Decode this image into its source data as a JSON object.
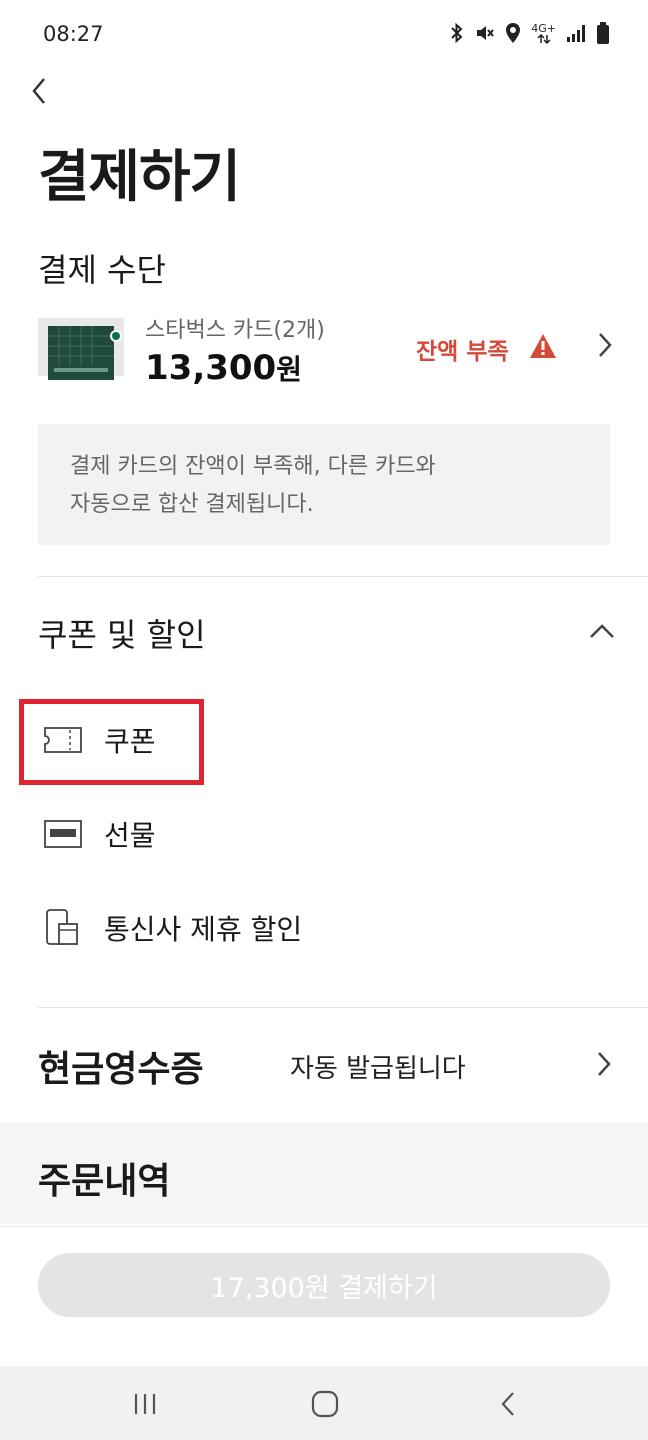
{
  "status_bar": {
    "time": "08:27",
    "icons": [
      "bluetooth-icon",
      "mute-icon",
      "location-icon",
      "network-4g-icon",
      "signal-icon",
      "battery-icon"
    ],
    "network_label": "4G+"
  },
  "header": {
    "back_icon": "chevron-left-icon",
    "title": "결제하기"
  },
  "payment_method": {
    "section_title": "결제 수단",
    "card": {
      "name": "스타벅스 카드(2개)",
      "amount": "13,300",
      "amount_unit": "원",
      "balance_status": "잔액 부족",
      "warning_icon": "warning-triangle-icon",
      "warning_color": "#d4493a"
    },
    "notice_line1": "결제 카드의 잔액이 부족해, 다른 카드와",
    "notice_line2": "자동으로 합산 결제됩니다."
  },
  "coupon_discount": {
    "section_title": "쿠폰 및 할인",
    "toggle_icon": "chevron-up-icon",
    "options": [
      {
        "icon": "coupon-ticket-icon",
        "label": "쿠폰"
      },
      {
        "icon": "gift-card-icon",
        "label": "선물"
      },
      {
        "icon": "mobile-carrier-icon",
        "label": "통신사 제휴 할인"
      }
    ],
    "highlight_color": "#e02531"
  },
  "cash_receipt": {
    "title": "현금영수증",
    "value": "자동 발급됩니다"
  },
  "order_history": {
    "title": "주문내역"
  },
  "pay_button": {
    "label": "17,300원 결제하기",
    "state": "disabled"
  },
  "nav_bar": {
    "icons": [
      "recent-apps-icon",
      "home-icon",
      "back-icon"
    ]
  }
}
